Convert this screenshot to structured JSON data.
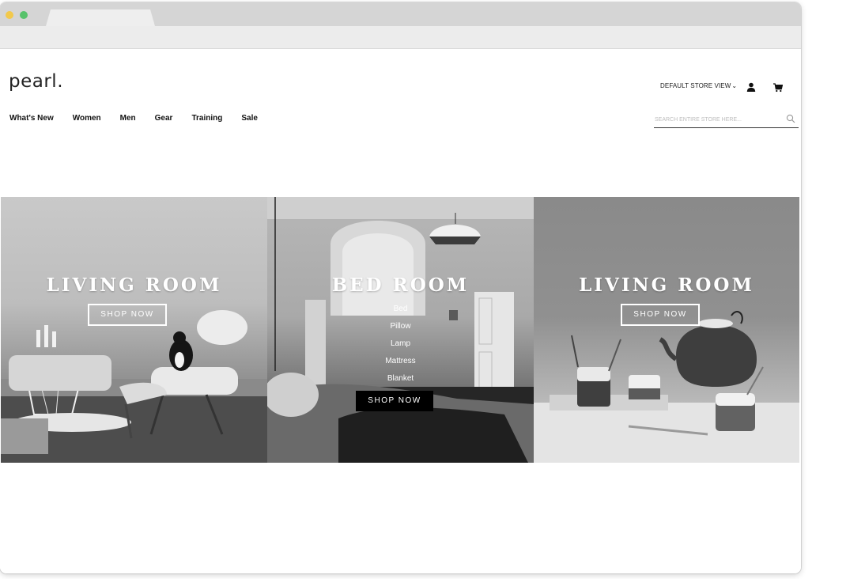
{
  "brand": {
    "logo": "pearl."
  },
  "nav": [
    {
      "label": "What's New"
    },
    {
      "label": "Women"
    },
    {
      "label": "Men"
    },
    {
      "label": "Gear"
    },
    {
      "label": "Training"
    },
    {
      "label": "Sale"
    }
  ],
  "header": {
    "store_view": "DEFAULT STORE VIEW",
    "search_placeholder": "SEARCH ENTIRE STORE HERE..."
  },
  "banners": [
    {
      "title": "LIVING ROOM",
      "button": "SHOP NOW"
    },
    {
      "title": "BED ROOM",
      "links": [
        "Bed",
        "Pillow",
        "Lamp",
        "Mattress",
        "Blanket"
      ],
      "button": "SHOP NOW"
    },
    {
      "title": "LIVING ROOM",
      "button": "SHOP NOW"
    }
  ],
  "colors": {
    "window_dot_yellow": "#f2c94c",
    "window_dot_green": "#57c26b",
    "button_dark": "#000000"
  }
}
